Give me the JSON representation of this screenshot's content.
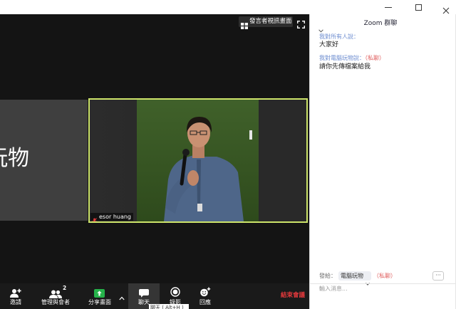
{
  "window": {
    "controls": [
      {
        "name": "minimize",
        "icon": "minimize-icon"
      },
      {
        "name": "maximize",
        "icon": "maximize-icon"
      },
      {
        "name": "close",
        "icon": "close-icon"
      }
    ]
  },
  "video": {
    "speaker_view_button": {
      "label": "發言者視訊畫面",
      "icon": "grid-icon"
    },
    "fullscreen_icon": "fullscreen-icon",
    "side_tile": {
      "text": "玩物"
    },
    "active_tile": {
      "name": "esor huang",
      "mic_icon": "mic-muted-icon",
      "muted": true
    }
  },
  "toolbar": {
    "items": [
      {
        "label": "邀請",
        "icon": "add-person-icon"
      },
      {
        "label": "管理與會者",
        "icon": "participants-icon",
        "badge": "2"
      },
      {
        "label": "分享畫面",
        "icon": "share-screen-icon"
      },
      {
        "label": "聊天",
        "icon": "chat-icon",
        "active": true
      },
      {
        "label": "錄影",
        "icon": "record-icon"
      },
      {
        "label": "回應",
        "icon": "reactions-icon"
      }
    ],
    "share_options_icon": "chevron-up-icon",
    "end_meeting_label": "結束會議",
    "tooltip": "聊天 ( Alt+H )"
  },
  "chat": {
    "title": "Zoom 群聊",
    "collapse_icon": "chevron-down-icon",
    "messages": [
      {
        "sender": "我對所有人說：",
        "text": "大家好"
      },
      {
        "sender": "我對電腦玩物說：",
        "private_tag": "（私聊）",
        "text": "請你先傳檔案給我"
      }
    ],
    "compose": {
      "to_label": "發給：",
      "recipient": "電腦玩物",
      "private_tag": "（私聊）",
      "more": "···",
      "placeholder": "輸入消息..."
    }
  },
  "colors": {
    "active_speaker_border": "#cde46a",
    "share_green": "#26b34a",
    "end_meeting_red": "#e4393c",
    "private_tag_red": "#e06060",
    "sender_blue": "#6d8dd0"
  }
}
